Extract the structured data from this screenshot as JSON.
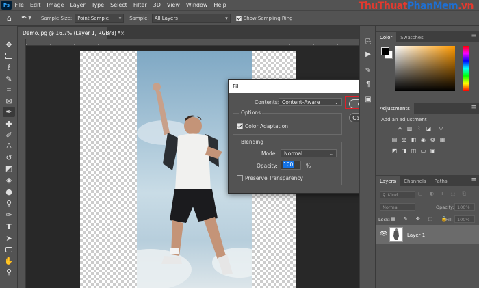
{
  "app": {
    "logo": "Ps"
  },
  "menu": [
    "File",
    "Edit",
    "Image",
    "Layer",
    "Type",
    "Select",
    "Filter",
    "3D",
    "View",
    "Window",
    "Help"
  ],
  "watermark": {
    "part1": "ThuThuat",
    "part2": "PhanMem",
    "part3": ".vn"
  },
  "options": {
    "sample_size_label": "Sample Size:",
    "sample_size_value": "Point Sample",
    "sample_label": "Sample:",
    "sample_value": "All Layers",
    "show_ring_label": "Show Sampling Ring",
    "show_ring_checked": true
  },
  "document": {
    "tab_title": "Demo.jpg @ 16.7% (Layer 1, RGB/8) *",
    "close": "×"
  },
  "dialog": {
    "title": "Fill",
    "close": "✕",
    "contents_label": "Contents:",
    "contents_value": "Content-Aware",
    "options_group": "Options",
    "color_adaptation_label": "Color Adaptation",
    "color_adaptation_checked": true,
    "blending_group": "Blending",
    "mode_label": "Mode:",
    "mode_value": "Normal",
    "opacity_label": "Opacity:",
    "opacity_value": "100",
    "opacity_unit": "%",
    "preserve_label": "Preserve Transparency",
    "preserve_checked": false,
    "ok_label": "OK",
    "cancel_label": "Cancel"
  },
  "panels": {
    "color_tabs": [
      "Color",
      "Swatches"
    ],
    "adjustments_tab": "Adjustments",
    "adjustments_hint": "Add an adjustment",
    "layers_tabs": [
      "Layers",
      "Channels",
      "Paths"
    ],
    "kind_placeholder": "Kind",
    "blend_mode": "Normal",
    "opacity_label": "Opacity:",
    "opacity_value": "100%",
    "lock_label": "Lock:",
    "fill_label": "Fill:",
    "fill_value": "100%",
    "layer_name": "Layer 1"
  },
  "colors": {
    "annotation": "#e0202a",
    "accent_blue": "#1473e6"
  }
}
